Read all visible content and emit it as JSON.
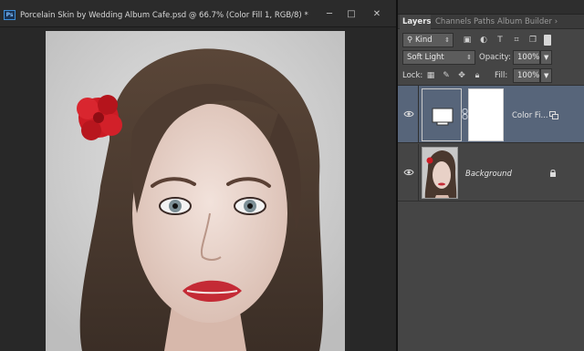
{
  "document": {
    "title": "Porcelain Skin by Wedding Album Cafe.psd @ 66.7% (Color Fill 1, RGB/8) *",
    "app_icon": "photoshop-logo-icon",
    "app_icon_text": "Ps",
    "window_buttons": {
      "minimize": "─",
      "maximize": "□",
      "close": "✕"
    },
    "canvas_image": "portrait of a woman with brown hair and a red flower"
  },
  "layers_panel": {
    "tabs": [
      {
        "label": "Layers",
        "active": true
      },
      {
        "label": "Channels",
        "active": false
      },
      {
        "label": "Paths",
        "active": false
      },
      {
        "label": "Album Builder ›",
        "active": false
      }
    ],
    "filter": {
      "kind": "Kind",
      "icons": [
        "image-filter-icon",
        "adjustment-filter-icon",
        "type-filter-icon",
        "shape-filter-icon",
        "smart-object-filter-icon",
        "filter-toggle-icon"
      ]
    },
    "blend_mode": "Soft Light",
    "opacity_label": "Opacity:",
    "opacity_value": "100%",
    "lock_label": "Lock:",
    "lock_icons": [
      "lock-transparent-icon",
      "lock-image-icon",
      "lock-position-icon",
      "lock-all-icon"
    ],
    "fill_label": "Fill:",
    "fill_value": "100%",
    "layers": [
      {
        "name": "Color Fi...",
        "selected": true,
        "visible": true,
        "type": "color-fill"
      },
      {
        "name": "Background",
        "selected": false,
        "visible": true,
        "locked": true,
        "type": "image"
      }
    ]
  },
  "colors": {
    "selected_layer": "#57657a",
    "flower": "#cc1b24",
    "hair": "#4a3a30",
    "lips": "#c42a35"
  }
}
